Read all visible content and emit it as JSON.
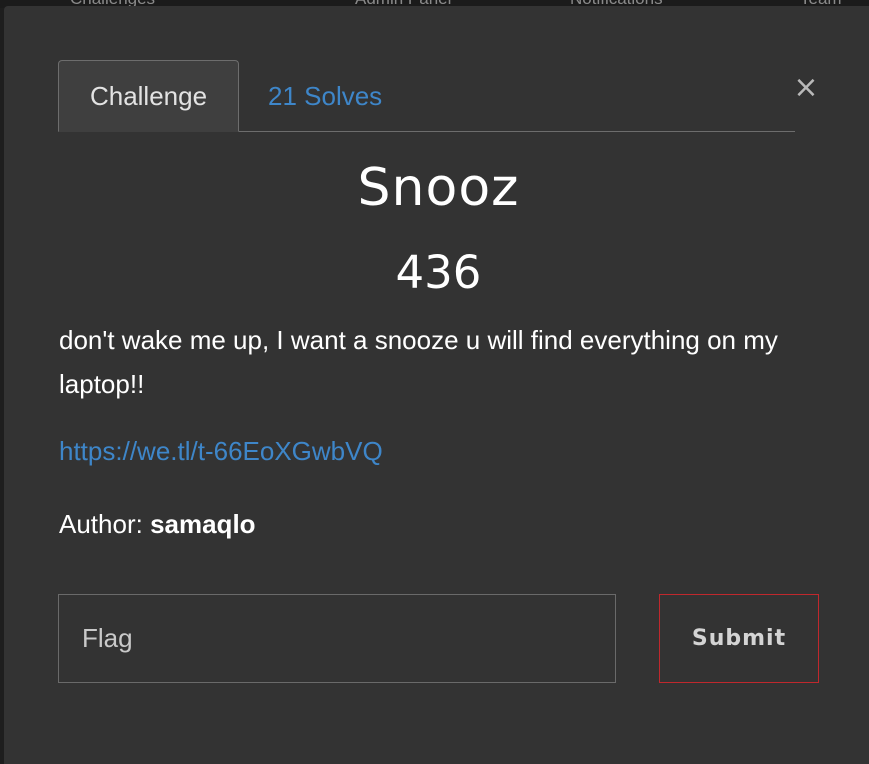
{
  "backdrop_nav": {
    "items": [
      "Challenges",
      "Admin Panel",
      "Notifications",
      "Team"
    ]
  },
  "modal": {
    "close_icon": "×",
    "tabs": {
      "challenge_label": "Challenge",
      "solves_label": "21 Solves"
    },
    "challenge": {
      "name": "Snooz",
      "points": "436",
      "description": "don't wake me up, I want a snooze u will find everything on my laptop!!",
      "link": "https://we.tl/t-66EoXGwbVQ",
      "author_label": "Author:",
      "author_name": "samaqlo"
    },
    "flag_form": {
      "placeholder": "Flag",
      "value": "",
      "submit_label": "Submit"
    }
  },
  "colors": {
    "modal_bg": "#333333",
    "link": "#3e86c9",
    "submit_border": "#c0282d",
    "text": "#ffffff"
  }
}
